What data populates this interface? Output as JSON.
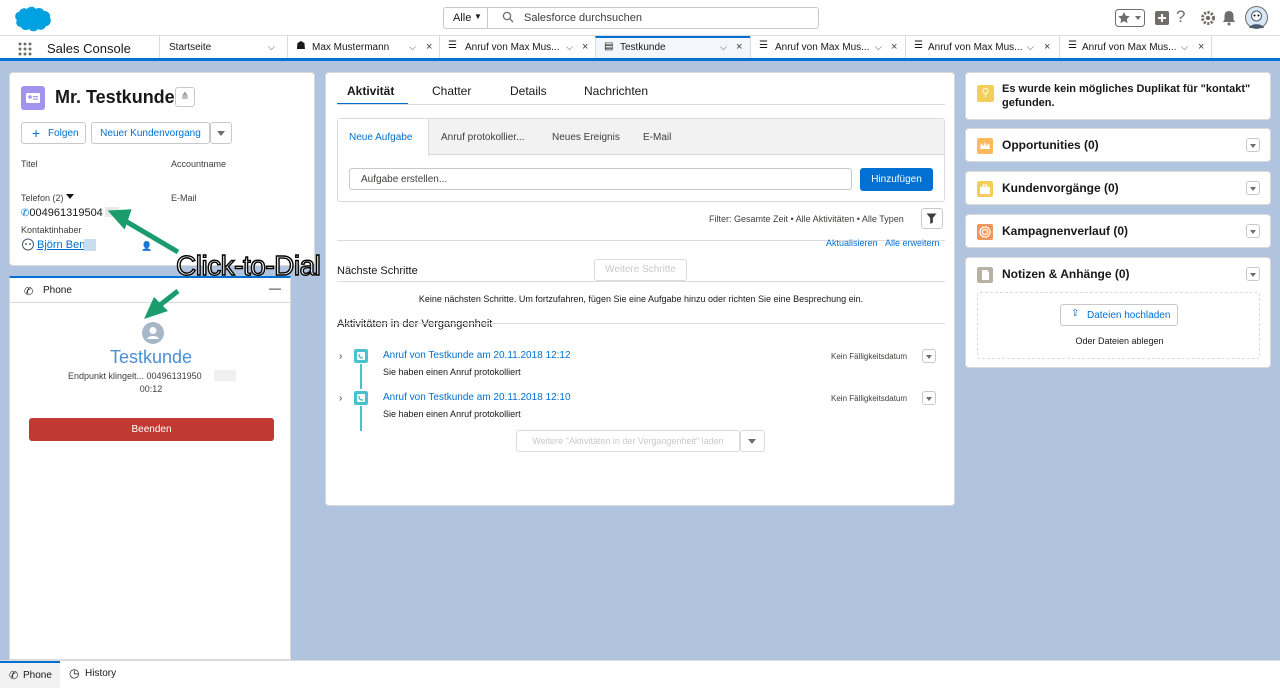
{
  "header": {
    "search_scope": "Alle",
    "search_placeholder": "Salesforce durchsuchen"
  },
  "nav": {
    "app_name": "Sales Console",
    "tabs": [
      {
        "label": "Startseite"
      },
      {
        "label": "Max Mustermann"
      },
      {
        "label": "Anruf von Max Mus..."
      },
      {
        "label": "Testkunde"
      },
      {
        "label": "Anruf von Max Mus..."
      },
      {
        "label": "Anruf von Max Mus..."
      },
      {
        "label": "Anruf von Max Mus..."
      }
    ]
  },
  "contact": {
    "title": "Mr. Testkunde",
    "follow_label": "Folgen",
    "new_case_label": "Neuer Kundenvorgang",
    "field_title_label": "Titel",
    "field_account_label": "Accountname",
    "field_phone_label": "Telefon (2)",
    "field_phone_value": "004961319504",
    "field_email_label": "E-Mail",
    "field_owner_label": "Kontaktinhaber",
    "field_owner_value": "Björn Ben"
  },
  "phone": {
    "header_label": "Phone",
    "caller_name": "Testkunde",
    "status": "Endpunkt klingelt... 00496131950",
    "timer": "00:12",
    "end_label": "Beenden"
  },
  "annotation": {
    "text": "Click-to-Dial"
  },
  "main": {
    "tabs": [
      "Aktivität",
      "Chatter",
      "Details",
      "Nachrichten"
    ],
    "composer_tabs": [
      "Neue Aufgabe",
      "Anruf protokollier...",
      "Neues Ereignis",
      "E-Mail"
    ],
    "task_placeholder": "Aufgabe erstellen...",
    "add_label": "Hinzufügen",
    "filter_text": "Filter: Gesamte Zeit • Alle Aktivitäten • Alle Typen",
    "refresh_label": "Aktualisieren",
    "expand_label": "Alle erweitern",
    "next_steps_title": "Nächste Schritte",
    "more_steps_label": "Weitere Schritte",
    "next_steps_empty": "Keine nächsten Schritte. Um fortzufahren, fügen Sie eine Aufgabe hinzu oder richten Sie eine Besprechung ein.",
    "past_title": "Aktivitäten in der Vergangenheit",
    "activities": [
      {
        "title": "Anruf von Testkunde am 20.11.2018 12:12",
        "sub": "Sie haben einen Anruf protokolliert",
        "due": "Kein Fälligkeitsdatum"
      },
      {
        "title": "Anruf von Testkunde am 20.11.2018 12:10",
        "sub": "Sie haben einen Anruf protokolliert",
        "due": "Kein Fälligkeitsdatum"
      }
    ],
    "load_more_label": "Weitere \"Aktivitäten in der Vergangenheit\" laden"
  },
  "right": {
    "duplicate_text": "Es wurde kein mögliches Duplikat für \"kontakt\" gefunden.",
    "sections": [
      {
        "label": "Opportunities (0)",
        "color": "#fcb95b"
      },
      {
        "label": "Kundenvorgänge (0)",
        "color": "#f2cf5b"
      },
      {
        "label": "Kampagnenverlauf (0)",
        "color": "#f49756"
      },
      {
        "label": "Notizen & Anhänge (0)",
        "color": "#8c89f2"
      }
    ],
    "upload_label": "Dateien hochladen",
    "drop_label": "Oder Dateien ablegen"
  },
  "utility": {
    "phone_label": "Phone",
    "history_label": "History"
  },
  "colors": {
    "brand": "#0070d2",
    "end_call": "#c23934",
    "background": "#b0c4df"
  }
}
